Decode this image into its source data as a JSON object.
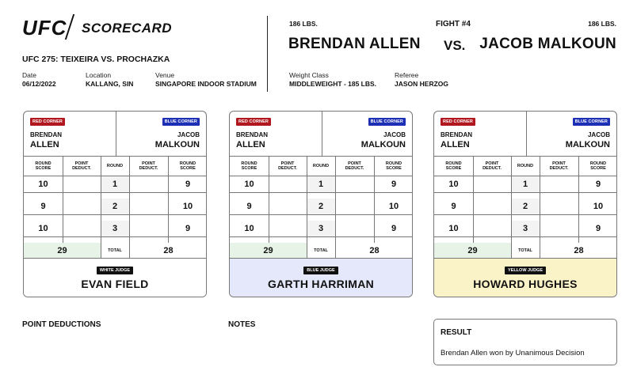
{
  "header": {
    "logo": "UFC",
    "title": "SCORECARD",
    "event": "UFC 275: TEIXEIRA VS. PROCHAZKA",
    "date_label": "Date",
    "date_value": "06/12/2022",
    "location_label": "Location",
    "location_value": "KALLANG, SIN",
    "venue_label": "Venue",
    "venue_value": "SINGAPORE INDOOR STADIUM"
  },
  "fight": {
    "number": "FIGHT #4",
    "red_weight": "186 LBS.",
    "blue_weight": "186 LBS.",
    "red_fighter": "BRENDAN ALLEN",
    "vs": "VS.",
    "blue_fighter": "JACOB MALKOUN",
    "weight_class_label": "Weight Class",
    "weight_class_value": "MIDDLEWEIGHT - 185 LBS.",
    "referee_label": "Referee",
    "referee_value": "JASON HERZOG"
  },
  "table_labels": {
    "red_corner": "RED CORNER",
    "blue_corner": "BLUE CORNER",
    "round_score": [
      "ROUND",
      "SCORE"
    ],
    "point_deduct": [
      "POINT",
      "DEDUCT."
    ],
    "round": "ROUND",
    "total": "TOTAL"
  },
  "fighters": {
    "red_first": "BRENDAN",
    "red_last": "ALLEN",
    "blue_first": "JACOB",
    "blue_last": "MALKOUN"
  },
  "cards": [
    {
      "judge_label": "WHITE JUDGE",
      "judge_name": "EVAN FIELD",
      "judge_bg": "#ffffff",
      "rows": [
        {
          "red": "10",
          "red_ded": "",
          "round": "1",
          "blue_ded": "",
          "blue": "9"
        },
        {
          "red": "9",
          "red_ded": "",
          "round": "2",
          "blue_ded": "",
          "blue": "10"
        },
        {
          "red": "10",
          "red_ded": "",
          "round": "3",
          "blue_ded": "",
          "blue": "9"
        }
      ],
      "red_total": "29",
      "blue_total": "28"
    },
    {
      "judge_label": "BLUE JUDGE",
      "judge_name": "GARTH HARRIMAN",
      "judge_bg": "#e4e8fa",
      "rows": [
        {
          "red": "10",
          "red_ded": "",
          "round": "1",
          "blue_ded": "",
          "blue": "9"
        },
        {
          "red": "9",
          "red_ded": "",
          "round": "2",
          "blue_ded": "",
          "blue": "10"
        },
        {
          "red": "10",
          "red_ded": "",
          "round": "3",
          "blue_ded": "",
          "blue": "9"
        }
      ],
      "red_total": "29",
      "blue_total": "28"
    },
    {
      "judge_label": "YELLOW JUDGE",
      "judge_name": "HOWARD HUGHES",
      "judge_bg": "#faf3c8",
      "rows": [
        {
          "red": "10",
          "red_ded": "",
          "round": "1",
          "blue_ded": "",
          "blue": "9"
        },
        {
          "red": "9",
          "red_ded": "",
          "round": "2",
          "blue_ded": "",
          "blue": "10"
        },
        {
          "red": "10",
          "red_ded": "",
          "round": "3",
          "blue_ded": "",
          "blue": "9"
        }
      ],
      "red_total": "29",
      "blue_total": "28"
    }
  ],
  "footer": {
    "point_deductions_label": "POINT DEDUCTIONS",
    "notes_label": "NOTES",
    "result_label": "RESULT",
    "result_text": "Brendan Allen won by Unanimous Decision"
  },
  "colors": {
    "red_corner": "#b0171f",
    "blue_corner": "#1d2fb5",
    "total_bg": "#e6f3e6"
  }
}
